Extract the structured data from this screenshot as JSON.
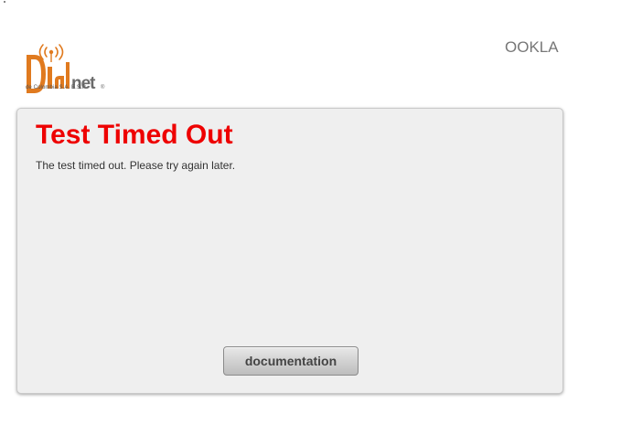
{
  "branding": {
    "logo_name": "Dialnet",
    "logo_subtitle": "de Colombia S.A. E.S.P",
    "partner_logo": "OOKLA",
    "logo_color": "#e07a1f"
  },
  "panel": {
    "title": "Test Timed Out",
    "message": "The test timed out. Please try again later.",
    "button_label": "documentation",
    "title_color": "#ee0000"
  }
}
